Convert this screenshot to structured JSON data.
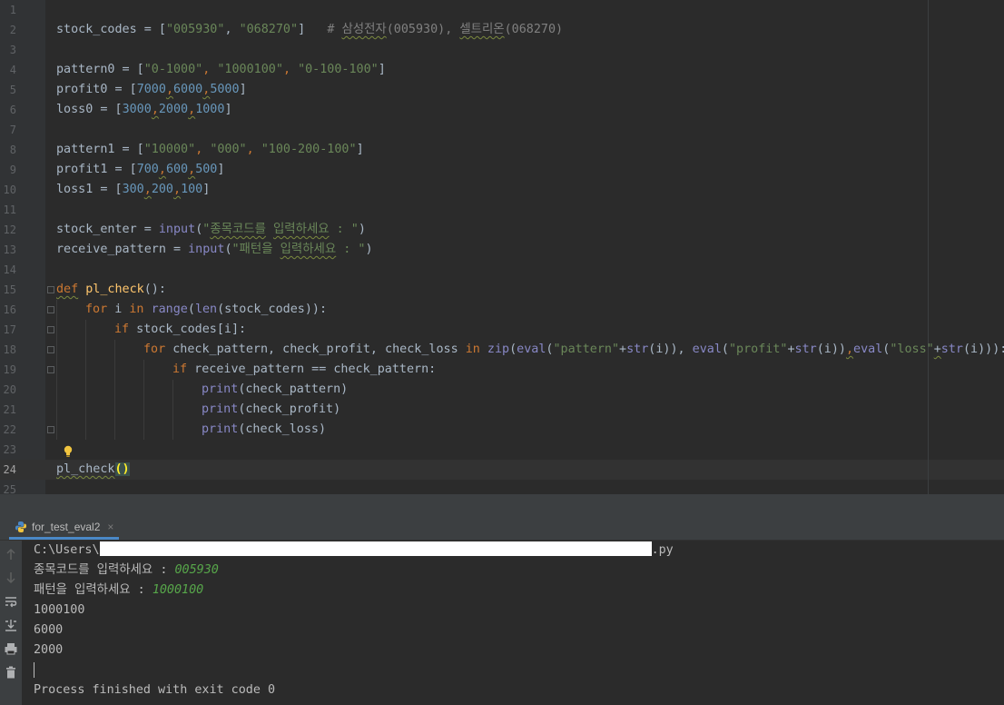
{
  "editor": {
    "line_numbers": [
      "1",
      "2",
      "3",
      "4",
      "5",
      "6",
      "7",
      "8",
      "9",
      "10",
      "11",
      "12",
      "13",
      "14",
      "15",
      "16",
      "17",
      "18",
      "19",
      "20",
      "21",
      "22",
      "23",
      "24",
      "25"
    ],
    "current_line": "24",
    "lines": {
      "l2": {
        "a": "stock_codes = [",
        "b": "\"005930\"",
        "c": ", ",
        "d": "\"068270\"",
        "e": "]   ",
        "f": "# ",
        "g": "삼성전자",
        "h": "(005930), ",
        "i": "셀트리온",
        "j": "(068270)"
      },
      "l4": {
        "a": "pattern0 = [",
        "b": "\"0-1000\"",
        "c": ", ",
        "d": "\"1000100\"",
        "e": ", ",
        "f": "\"0-100-100\"",
        "g": "]"
      },
      "l5": {
        "a": "profit0 = [",
        "b": "7000",
        "c": ",",
        "d": "6000",
        "e": ",",
        "f": "5000",
        "g": "]"
      },
      "l6": {
        "a": "loss0 = [",
        "b": "3000",
        "c": ",",
        "d": "2000",
        "e": ",",
        "f": "1000",
        "g": "]"
      },
      "l8": {
        "a": "pattern1 = [",
        "b": "\"10000\"",
        "c": ", ",
        "d": "\"000\"",
        "e": ", ",
        "f": "\"100-200-100\"",
        "g": "]"
      },
      "l9": {
        "a": "profit1 = [",
        "b": "700",
        "c": ",",
        "d": "600",
        "e": ",",
        "f": "500",
        "g": "]"
      },
      "l10": {
        "a": "loss1 = [",
        "b": "300",
        "c": ",",
        "d": "200",
        "e": ",",
        "f": "100",
        "g": "]"
      },
      "l12": {
        "a": "stock_enter = ",
        "b": "input",
        "c": "(",
        "d": "\"",
        "e": "종목코드를",
        "f": " ",
        "g": "입력하세요",
        "h": " : \"",
        "i": ")"
      },
      "l13": {
        "a": "receive_pattern = ",
        "b": "input",
        "c": "(",
        "d": "\"패턴을 ",
        "e": "입력하세요",
        "f": " : \"",
        "g": ")"
      },
      "l15": {
        "a": "def",
        "b": " ",
        "c": "pl_check",
        "d": "():"
      },
      "l16": {
        "a": "for",
        "b": " i ",
        "c": "in",
        "d": " ",
        "e": "range",
        "f": "(",
        "g": "len",
        "h": "(stock_codes)):"
      },
      "l17": {
        "a": "if",
        "b": " stock_codes[i]:"
      },
      "l18": {
        "a": "for",
        "b": " check_pattern, check_profit, check_loss ",
        "c": "in",
        "d": " ",
        "e": "zip",
        "f": "(",
        "g": "eval",
        "h": "(",
        "i": "\"pattern\"",
        "j": "+",
        "k": "str",
        "l": "(i)), ",
        "m": "eval",
        "n": "(",
        "o": "\"profit\"",
        "p": "+",
        "q": "str",
        "r": "(i))",
        "s": ",",
        "t": "eval",
        "u": "(",
        "v": "\"loss\"",
        "w": "+",
        "x": "str",
        "y": "(i))):"
      },
      "l19": {
        "a": "if",
        "b": " receive_pattern == check_pattern:"
      },
      "l20": {
        "a": "print",
        "b": "(check_pattern)"
      },
      "l21": {
        "a": "print",
        "b": "(check_profit)"
      },
      "l22": {
        "a": "print",
        "b": "(check_loss)"
      },
      "l24": {
        "a": "pl_check",
        "b": "()"
      }
    }
  },
  "run_panel": {
    "tab_label": "for_test_eval2",
    "tab_close": "×",
    "output": {
      "path_prefix": "C:\\Users\\",
      "path_suffix": ".py",
      "prompt1": "종목코드를 입력하세요 : ",
      "input1": "005930",
      "prompt2": "패턴을 입력하세요 : ",
      "input2": "1000100",
      "line4": "1000100",
      "line5": "6000",
      "line6": "2000",
      "exit": "Process finished with exit code 0"
    },
    "toolbar_icons": [
      "arrow-up-icon",
      "arrow-down-icon",
      "soft-wrap-icon",
      "scroll-to-end-icon",
      "print-icon",
      "trash-icon"
    ]
  }
}
